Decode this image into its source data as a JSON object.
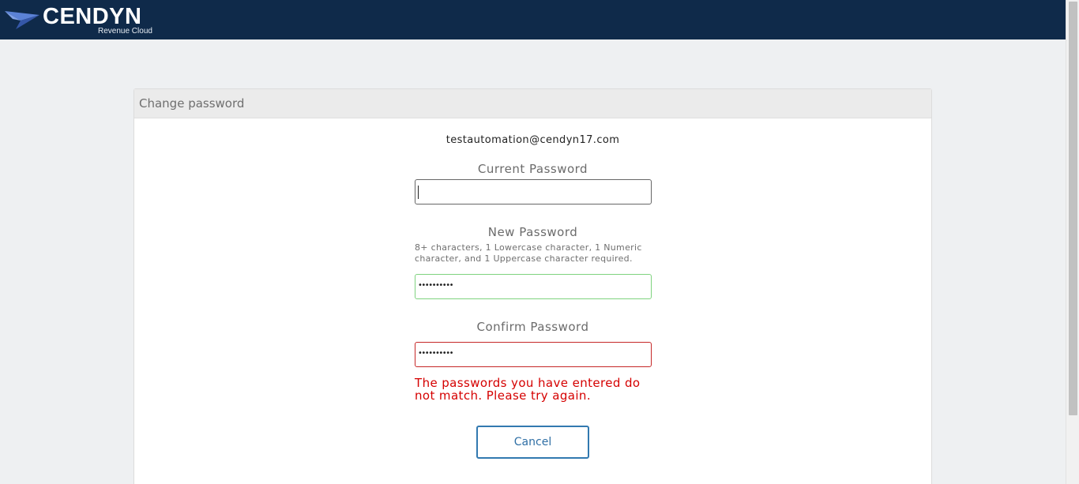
{
  "brand": {
    "name": "CENDYN",
    "product": "Revenue Cloud",
    "colors": {
      "header_bg": "#0f2a4a",
      "logo_mark": "#4f74c8",
      "error": "#d50000",
      "valid": "#7fd37f",
      "button": "#3279b0"
    }
  },
  "panel": {
    "title": "Change password",
    "email": "testautomation@cendyn17.com"
  },
  "form": {
    "current_password": {
      "label": "Current Password",
      "value": ""
    },
    "new_password": {
      "label": "New Password",
      "hint": "8+ characters, 1 Lowercase character, 1 Numeric character, and 1 Uppercase character required.",
      "masked_value": "••••••••••"
    },
    "confirm_password": {
      "label": "Confirm Password",
      "masked_value": "••••••••••",
      "error": "The passwords you have entered do not match. Please try again."
    },
    "cancel_label": "Cancel"
  }
}
